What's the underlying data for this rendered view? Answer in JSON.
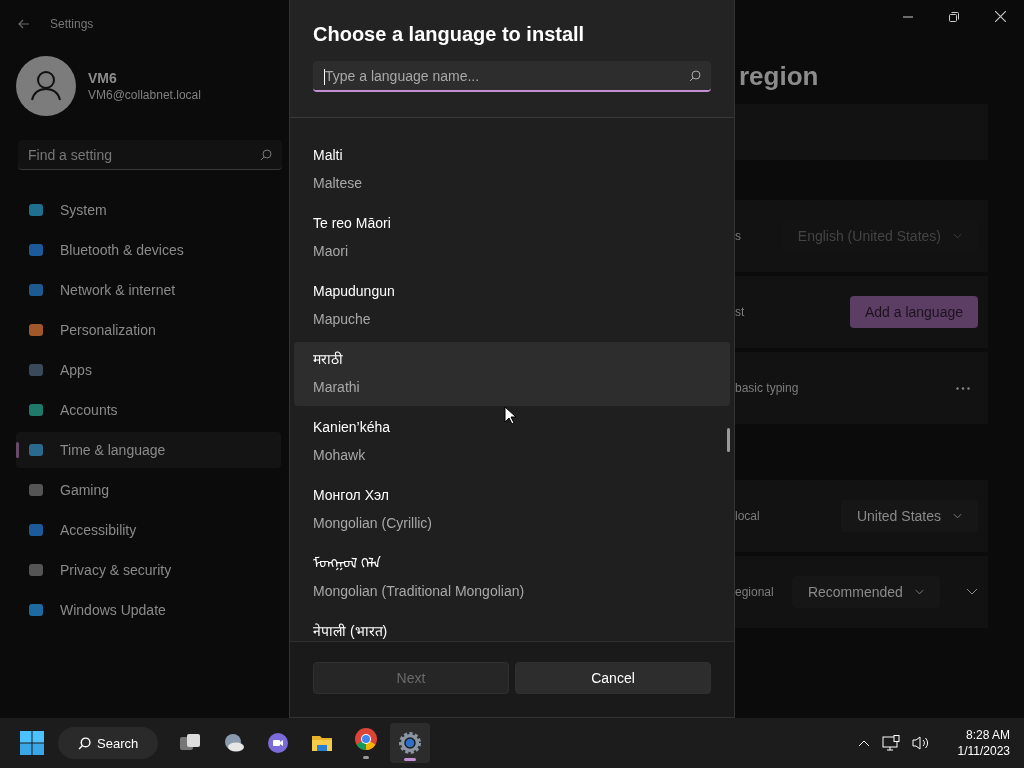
{
  "settings": {
    "title": "Settings",
    "user": {
      "name": "VM6",
      "email": "VM6@collabnet.local"
    },
    "search": {
      "placeholder": "Find a setting"
    },
    "nav": [
      {
        "label": "System",
        "selected": false
      },
      {
        "label": "Bluetooth & devices",
        "selected": false
      },
      {
        "label": "Network & internet",
        "selected": false
      },
      {
        "label": "Personalization",
        "selected": false
      },
      {
        "label": "Apps",
        "selected": false
      },
      {
        "label": "Accounts",
        "selected": false
      },
      {
        "label": "Time & language",
        "selected": true
      },
      {
        "label": "Gaming",
        "selected": false
      },
      {
        "label": "Accessibility",
        "selected": false
      },
      {
        "label": "Privacy & security",
        "selected": false
      },
      {
        "label": "Windows Update",
        "selected": false
      }
    ],
    "page_title": "region",
    "rows": [
      {
        "kind": "dropdown",
        "label": "s",
        "value": "English (United States)",
        "disabled": true
      },
      {
        "kind": "button",
        "label": "st",
        "value": "Add a language"
      },
      {
        "kind": "more",
        "label": "basic typing"
      },
      {
        "kind": "dropdown",
        "label": "local",
        "value": "United States",
        "disabled": false
      },
      {
        "kind": "expand",
        "label": "egional",
        "value": "Recommended",
        "disabled": false
      }
    ]
  },
  "dialog": {
    "title": "Choose a language to install",
    "search": {
      "placeholder": "Type a language name..."
    },
    "languages": [
      {
        "native": "Malti",
        "english": "Maltese",
        "selected": false
      },
      {
        "native": "Te reo Māori",
        "english": "Maori",
        "selected": false
      },
      {
        "native": "Mapudungun",
        "english": "Mapuche",
        "selected": false
      },
      {
        "native": "मराठी",
        "english": "Marathi",
        "selected": true
      },
      {
        "native": "Kanien’kéha",
        "english": "Mohawk",
        "selected": false
      },
      {
        "native": "Монгол Хэл",
        "english": "Mongolian (Cyrillic)",
        "selected": false
      },
      {
        "native": "ᠮᠣᠩᠭᠣᠯ ᠬᠡᠯᠡ",
        "english": "Mongolian (Traditional Mongolian)",
        "selected": false
      },
      {
        "native": "नेपाली (भारत)",
        "selected": false
      }
    ],
    "buttons": [
      {
        "label": "Next",
        "disabled": true
      },
      {
        "label": "Cancel",
        "disabled": false
      }
    ]
  },
  "taskbar": {
    "search_label": "Search",
    "time": "8:28 AM",
    "date": "1/11/2023"
  }
}
